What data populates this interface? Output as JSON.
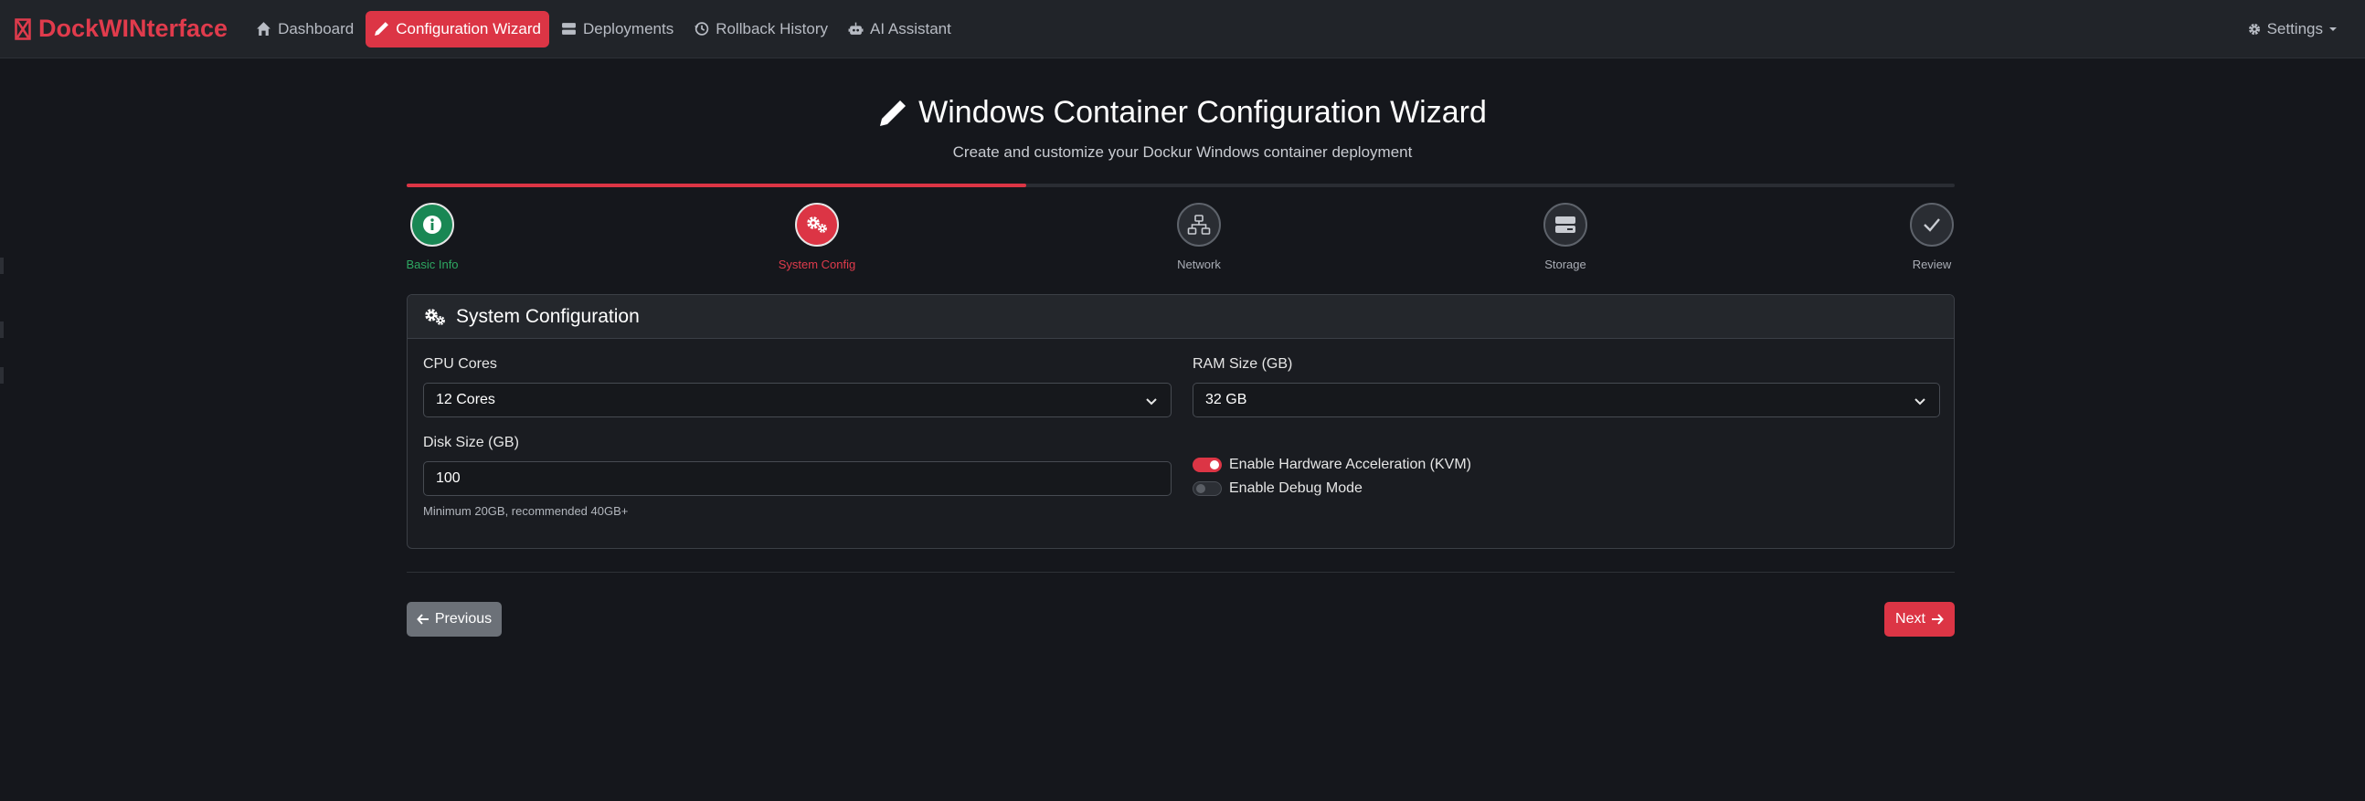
{
  "navbar": {
    "brand": "DockWINterface",
    "items": [
      {
        "label": "Dashboard",
        "icon": "home-icon",
        "active": false
      },
      {
        "label": "Configuration Wizard",
        "icon": "pencil-icon",
        "active": true
      },
      {
        "label": "Deployments",
        "icon": "server-icon",
        "active": false
      },
      {
        "label": "Rollback History",
        "icon": "history-icon",
        "active": false
      },
      {
        "label": "AI Assistant",
        "icon": "robot-icon",
        "active": false
      }
    ],
    "settings_label": "Settings"
  },
  "header": {
    "title": "Windows Container Configuration Wizard",
    "subtitle": "Create and customize your Dockur Windows container deployment"
  },
  "progress": {
    "fraction": 0.4
  },
  "steps": [
    {
      "label": "Basic Info",
      "state": "done",
      "icon": "info-icon"
    },
    {
      "label": "System Config",
      "state": "current",
      "icon": "gears-icon"
    },
    {
      "label": "Network",
      "state": "pending",
      "icon": "network-icon"
    },
    {
      "label": "Storage",
      "state": "pending",
      "icon": "storage-icon"
    },
    {
      "label": "Review",
      "state": "pending",
      "icon": "check-icon"
    }
  ],
  "card": {
    "title": "System Configuration",
    "cpu": {
      "label": "CPU Cores",
      "value": "12 Cores"
    },
    "ram": {
      "label": "RAM Size (GB)",
      "value": "32 GB"
    },
    "disk": {
      "label": "Disk Size (GB)",
      "value": "100",
      "hint": "Minimum 20GB, recommended 40GB+"
    },
    "kvm": {
      "label": "Enable Hardware Acceleration (KVM)",
      "checked": true
    },
    "debug": {
      "label": "Enable Debug Mode",
      "checked": false
    }
  },
  "buttons": {
    "previous": "Previous",
    "next": "Next"
  },
  "colors": {
    "accent": "#dc3545",
    "success": "#198754",
    "background": "#15171c",
    "navbar": "#212429"
  }
}
